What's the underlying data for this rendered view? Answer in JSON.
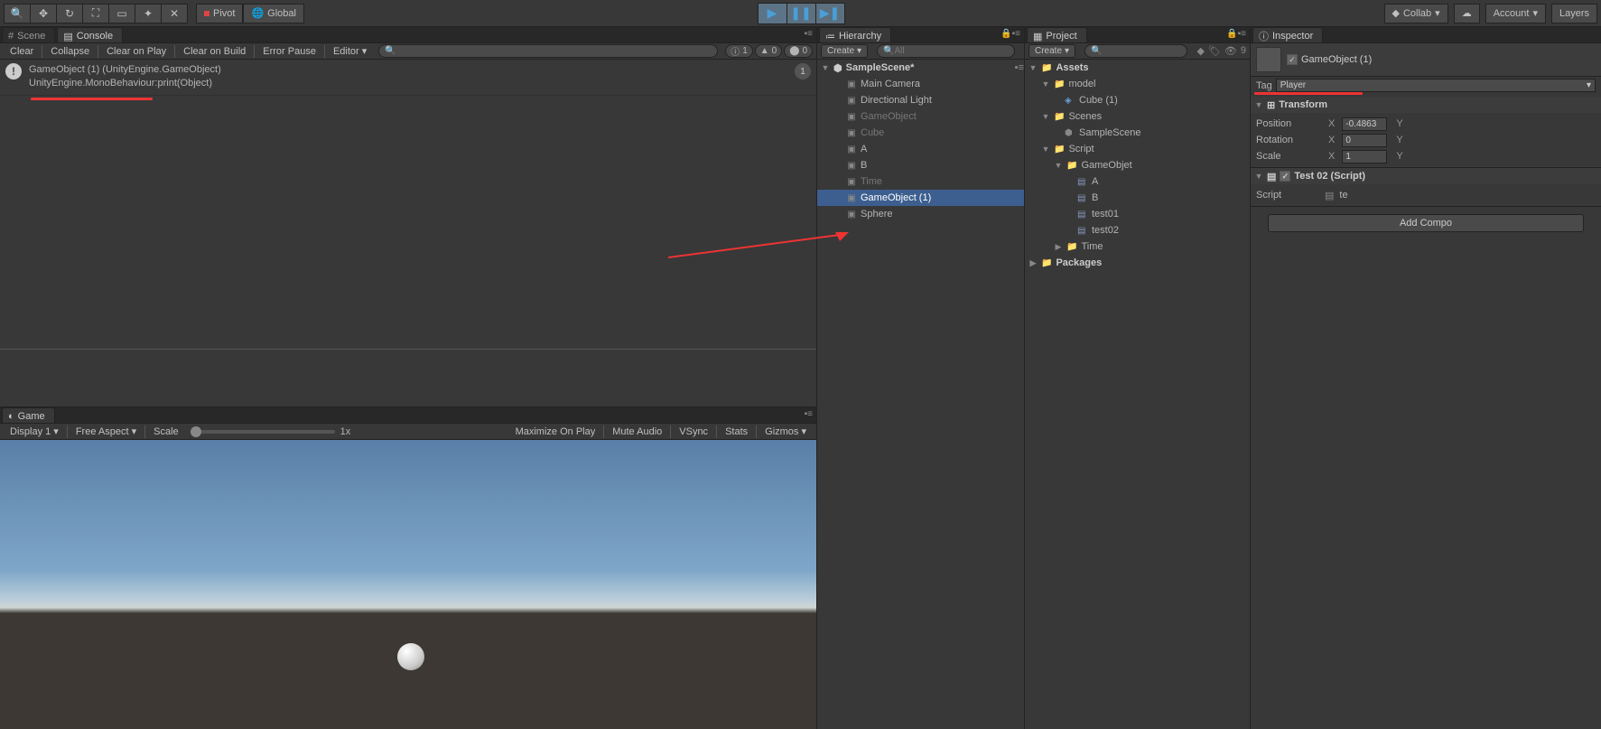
{
  "topbar": {
    "pivot": "Pivot",
    "global": "Global",
    "collab": "Collab",
    "account": "Account",
    "layers": "Layers"
  },
  "tabs": {
    "scene": "Scene",
    "console": "Console",
    "game": "Game",
    "hierarchy": "Hierarchy",
    "project": "Project",
    "inspector": "Inspector"
  },
  "console": {
    "clear": "Clear",
    "collapse": "Collapse",
    "clear_on_play": "Clear on Play",
    "clear_on_build": "Clear on Build",
    "error_pause": "Error Pause",
    "editor": "Editor",
    "info_count": "1",
    "warn_count": "0",
    "err_count": "0",
    "log": {
      "line1": "GameObject (1) (UnityEngine.GameObject)",
      "line2": "UnityEngine.MonoBehaviour:print(Object)",
      "count": "1"
    }
  },
  "game": {
    "display": "Display 1",
    "aspect": "Free Aspect",
    "scale": "Scale",
    "scale_val": "1x",
    "maximize": "Maximize On Play",
    "mute": "Mute Audio",
    "vsync": "VSync",
    "stats": "Stats",
    "gizmos": "Gizmos"
  },
  "hierarchy": {
    "create": "Create",
    "search_placeholder": "All",
    "scene": "SampleScene*",
    "items": [
      {
        "name": "Main Camera",
        "dim": false
      },
      {
        "name": "Directional Light",
        "dim": false
      },
      {
        "name": "GameObject",
        "dim": true
      },
      {
        "name": "Cube",
        "dim": true
      },
      {
        "name": "A",
        "dim": false
      },
      {
        "name": "B",
        "dim": false
      },
      {
        "name": "Time",
        "dim": true
      },
      {
        "name": "GameObject (1)",
        "dim": false,
        "selected": true
      },
      {
        "name": "Sphere",
        "dim": false
      }
    ]
  },
  "project": {
    "create": "Create",
    "hidden_count": "9",
    "root": "Assets",
    "model": "model",
    "cube": "Cube (1)",
    "scenes": "Scenes",
    "samplescene": "SampleScene",
    "script": "Script",
    "gameobjet": "GameObjet",
    "a": "A",
    "b": "B",
    "test01": "test01",
    "test02": "test02",
    "time": "Time",
    "packages": "Packages"
  },
  "inspector": {
    "obj_name": "GameObject (1)",
    "tag_label": "Tag",
    "tag_value": "Player",
    "transform": "Transform",
    "position": "Position",
    "rotation": "Rotation",
    "scale": "Scale",
    "pos_x": "-0.4863",
    "rot_x": "0",
    "scale_x": "1",
    "x": "X",
    "y": "Y",
    "component_name": "Test 02 (Script)",
    "script_label": "Script",
    "script_value": "te",
    "add_component": "Add Compo"
  }
}
